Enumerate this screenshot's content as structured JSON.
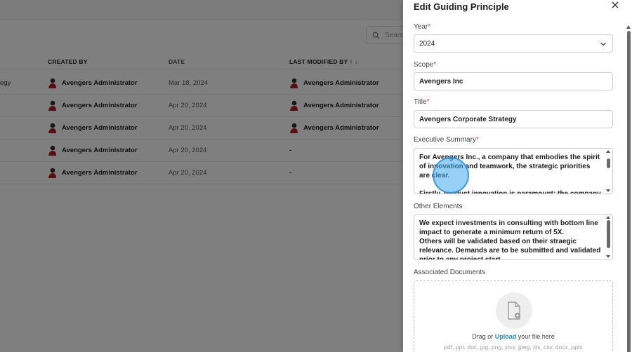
{
  "background": {
    "search_placeholder": "Search",
    "table": {
      "headers": [
        "CREATED BY",
        "DATE",
        "LAST MODIFIED BY ↑ ↓"
      ],
      "rows": [
        {
          "col0": "egy",
          "created_by": "Avengers Administrator",
          "date": "Mar 18, 2024",
          "modified_by": "Avengers Administrator"
        },
        {
          "col0": "",
          "created_by": "Avengers Administrator",
          "date": "Apr 20, 2024",
          "modified_by": "Avengers Administrator"
        },
        {
          "col0": "",
          "created_by": "Avengers Administrator",
          "date": "Apr 20, 2024",
          "modified_by": "Avengers Administrator"
        },
        {
          "col0": "",
          "created_by": "Avengers Administrator",
          "date": "Apr 20, 2024",
          "modified_by": "-"
        },
        {
          "col0": "",
          "created_by": "Avengers Administrator",
          "date": "Apr 20, 2024",
          "modified_by": "-"
        }
      ]
    }
  },
  "drawer": {
    "title": "Edit Guiding Principle",
    "year": {
      "label": "Year",
      "value": "2024"
    },
    "scope": {
      "label": "Scope",
      "value": "Avengers Inc"
    },
    "title_field": {
      "label": "Title",
      "value": "Avengers Corporate Strategy"
    },
    "executive_summary": {
      "label": "Executive Summary",
      "value": "For Avengers Inc., a company that embodies the spirit of innovation and teamwork, the strategic priorities are clear.\n\nFirstly, product innovation is paramount; the company"
    },
    "other_elements": {
      "label": "Other Elements",
      "value": "We expect investments in consulting with bottom line impact to generate a minimum return of 5X.\nOthers will be validated based on their straegic relevance. Demands are to be submitted and validated prior to any project start."
    },
    "documents": {
      "label": "Associated Documents",
      "drag_text": "Drag or",
      "upload_link": "Upload",
      "suffix_text": "your file here",
      "file_types": "pdf, ppt, doc, jpg, png, xlsx, jpeg, xls, csv, docx, pptx"
    },
    "required_marker": "*"
  },
  "colors": {
    "required": "#d32f2f",
    "link": "#1e88c8",
    "overlay": "rgba(0,0,0,0.5)",
    "cursor": "#40aaf0"
  }
}
